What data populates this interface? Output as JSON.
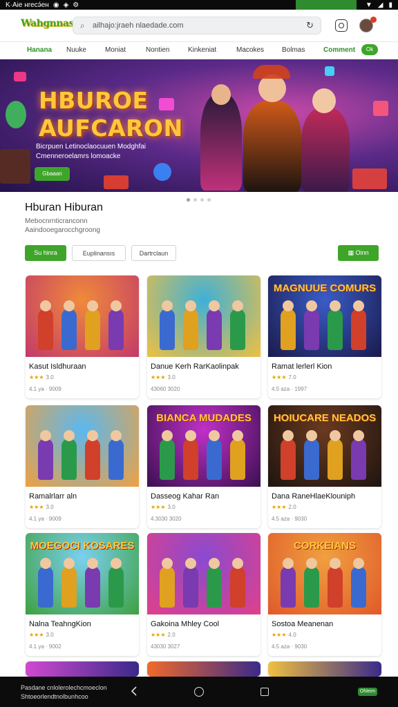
{
  "status_bar": {
    "left_text": "K·Aie нrecэ́ен",
    "icons": [
      "notification-icon",
      "vpn-icon",
      "settings-icon"
    ],
    "right_icons": [
      "wifi-icon",
      "signal-icon",
      "battery-icon"
    ]
  },
  "header": {
    "logo_text": "Wahgnnas",
    "search_placeholder": "ailhajo:jraeh nlaedade.com",
    "icons": [
      "search-icon",
      "reload-icon",
      "camera-icon"
    ]
  },
  "nav": {
    "items": [
      "Hanana",
      "Nuuke",
      "Moniat",
      "Nontien",
      "Kinkeniat",
      "Macokes",
      "Bolmas",
      "Comment"
    ],
    "active_index": 0,
    "pill": "Ok"
  },
  "hero": {
    "title_line1": "HBUROE",
    "title_line2": "AUFCARON",
    "desc_line1": "Bicrpuen Letinoclaocuuen Modghfai",
    "desc_line2": "Cmenneroelamrs lomoacke",
    "cta_label": "Gbaaan"
  },
  "section": {
    "title": "Hburan Hiburan",
    "subtitle_line1": "Mebocnrnticranconn",
    "subtitle_line2": "Aaindooegarocchgroong",
    "btn_primary": "Su hinra",
    "btn_outline1": "Euplinansıs",
    "btn_outline2": "Dartrclaun",
    "btn_right": "Oinn"
  },
  "cards": [
    {
      "name": "Kasut Isldhuraan",
      "rating": "3.0",
      "meta": "4.1 ya · 9009",
      "art": ""
    },
    {
      "name": "Danue Kerh RarKaolinpak",
      "rating": "3.0",
      "meta": "43060 3020",
      "art": ""
    },
    {
      "name": "Ramat lerlerl Kion",
      "rating": "7.0",
      "meta": "4.5 aza · 1997",
      "art": "MAGNUUE COMURS"
    },
    {
      "name": "Ramalrlarr aln",
      "rating": "3.0",
      "meta": "4.1 ya · 9009",
      "art": ""
    },
    {
      "name": "Dasseog Kahar Ran",
      "rating": "3.0",
      "meta": "4.3030 3020",
      "art": "BIANCA MUDADES"
    },
    {
      "name": "Dana RaneHlaeKlouniph",
      "rating": "2.0",
      "meta": "4.5 aza · 9030",
      "art": "HOIUCARE NEADOS"
    },
    {
      "name": "Nalna TeahngKion",
      "rating": "3.0",
      "meta": "4.1 ya · 9002",
      "art": "MOEGOCI KOSARES"
    },
    {
      "name": "Gakoina Mhley Cool",
      "rating": "2.0",
      "meta": "43030 3027",
      "art": ""
    },
    {
      "name": "Sostoa Meanenan",
      "rating": "4.0",
      "meta": "4.5 aza · 9030",
      "art": "CORKEIANS"
    }
  ],
  "bottom_bar": {
    "line1": "Pasdane cnlolerolechcmoeclon",
    "line2": "Shtoeorlendtnolbunhcoo",
    "pill": "Ohleim"
  }
}
